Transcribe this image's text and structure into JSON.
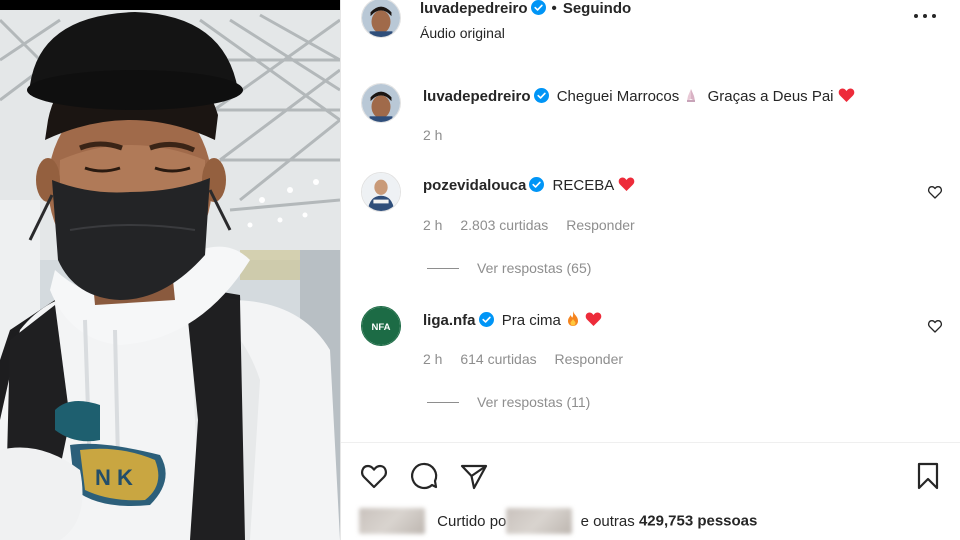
{
  "post": {
    "author": "luvadepedreiro",
    "follow_status": "Seguindo",
    "audio": "Áudio original"
  },
  "caption": {
    "author": "luvadepedreiro",
    "text_before": "Cheguei Marrocos",
    "text_after": "Graças a Deus Pai",
    "time": "2 h"
  },
  "comments": [
    {
      "author": "pozevidalouca",
      "text": "RECEBA",
      "time": "2 h",
      "likes": "2.803 curtidas",
      "reply_label": "Responder",
      "view_replies": "Ver respostas (65)"
    },
    {
      "author": "liga.nfa",
      "avatar_text": "NFA",
      "text": "Pra cima",
      "time": "2 h",
      "likes": "614 curtidas",
      "reply_label": "Responder",
      "view_replies": "Ver respostas (11)"
    }
  ],
  "likes_summary": {
    "prefix": "Curtido po",
    "middle": "e outras",
    "count_text": "429,753 pessoas"
  },
  "icons": {
    "more": "more-options-icon",
    "verified": "verified-badge-icon",
    "heart": "heart-icon",
    "comment": "comment-icon",
    "share": "share-icon",
    "save": "bookmark-icon"
  },
  "colors": {
    "verified_blue": "#0095f6",
    "heart_red": "#ed4956",
    "nfa_green": "#1c6b45",
    "text": "#262626",
    "muted": "#8e8e8e"
  }
}
